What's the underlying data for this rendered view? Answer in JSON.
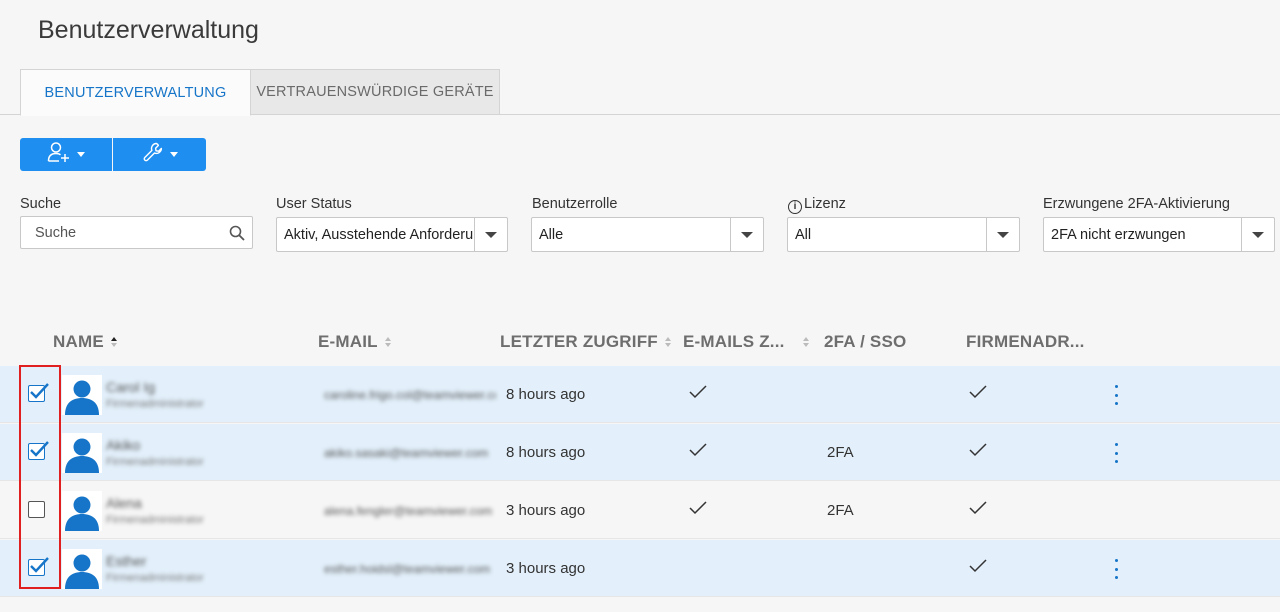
{
  "page": {
    "title": "Benutzerverwaltung"
  },
  "tabs": [
    {
      "label": "BENUTZERVERWALTUNG",
      "active": true
    },
    {
      "label": "VERTRAUENSWÜRDIGE GERÄTE",
      "active": false
    }
  ],
  "toolbar": {
    "add_user_icon": "add-user-icon",
    "tools_icon": "wrench-icon"
  },
  "filters": {
    "search": {
      "label": "Suche",
      "placeholder": "Suche"
    },
    "user_status": {
      "label": "User Status",
      "value": "Aktiv, Ausstehende Anforderung"
    },
    "role": {
      "label": "Benutzerrolle",
      "value": "Alle"
    },
    "license": {
      "label": "Lizenz",
      "value": "All"
    },
    "twofa": {
      "label": "Erzwungene 2FA-Aktivierung",
      "value": "2FA nicht erzwungen"
    }
  },
  "table": {
    "columns": [
      "NAME",
      "E-MAIL",
      "LETZTER ZUGRIFF",
      "E-MAILS Z...",
      "2FA / SSO",
      "FIRMENADR..."
    ],
    "rows": [
      {
        "selected": true,
        "name": "Carol Ig",
        "role": "Firmenadministrator",
        "email": "caroline.frigo.col@teamviewer.com",
        "last_access": "8 hours ago",
        "emails_z": true,
        "twofa": "",
        "firmenadr": true,
        "menu": true
      },
      {
        "selected": true,
        "name": "Akiko",
        "role": "Firmenadministrator",
        "email": "akiko.sasaki@teamviewer.com",
        "last_access": "8 hours ago",
        "emails_z": true,
        "twofa": "2FA",
        "firmenadr": true,
        "menu": true
      },
      {
        "selected": false,
        "name": "Alena",
        "role": "Firmenadministrator",
        "email": "alena.fengler@teamviewer.com",
        "last_access": "3 hours ago",
        "emails_z": true,
        "twofa": "2FA",
        "firmenadr": true,
        "menu": false
      },
      {
        "selected": true,
        "name": "Esther",
        "role": "Firmenadministrator",
        "email": "esther.hoidsl@teamviewer.com",
        "last_access": "3 hours ago",
        "emails_z": false,
        "twofa": "",
        "firmenadr": true,
        "menu": true
      }
    ]
  },
  "colors": {
    "accent": "#1e8ff0",
    "link": "#1675c8",
    "selected_row": "#e3f0fb",
    "highlight": "#e02020"
  }
}
